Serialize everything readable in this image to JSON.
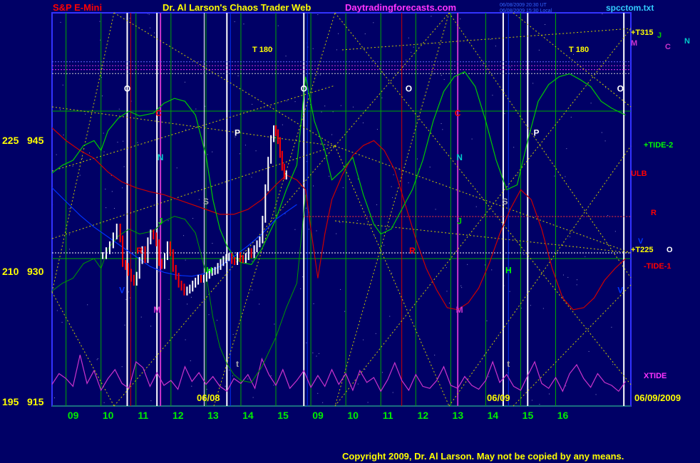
{
  "header": {
    "instrument": "S&P E-Mini",
    "title": "Dr. Al Larson's Chaos Trader Web",
    "site": "Daytradingforecasts.com",
    "stamp_ut": "06/08/2009 20:30 UT",
    "stamp_local": "06/08/2009 15:30 Local",
    "file": "spcctom.txt"
  },
  "footer": {
    "copyright": "Copyright 2009, Dr. Al Larson. May not be copied by any means."
  },
  "colors": {
    "background": "#000066",
    "border": "#3333ff",
    "grid": "#00aa00",
    "price_up": "#ffffff",
    "price_down": "#ff0000",
    "xtide": "#cc33cc",
    "tide": "#00cc00",
    "red_line": "#cc0000",
    "blue_line": "#0033ff",
    "yellow": "#ffff00",
    "dotted_yellow": "#cccc00"
  },
  "chart_data": {
    "type": "candlestick",
    "yaxis": {
      "ylim": [
        915,
        955
      ],
      "ticks": [
        {
          "left": "225",
          "right": "945",
          "value": 945
        },
        {
          "left": "210",
          "right": "930",
          "value": 930
        },
        {
          "left": "195",
          "right": "915",
          "value": 915
        }
      ]
    },
    "xaxis": {
      "session1_hours": [
        "09",
        "10",
        "11",
        "12",
        "13",
        "14",
        "15",
        "16"
      ],
      "session2_hours": [
        "09",
        "10",
        "11",
        "12",
        "13",
        "14",
        "15",
        "16"
      ],
      "date1": "06/08",
      "date2": "06/09",
      "date_end": "06/09/2009"
    },
    "right_labels": [
      {
        "text": "+T315",
        "color": "#ffff00"
      },
      {
        "text": "J",
        "color": "#00cc00"
      },
      {
        "text": "N",
        "color": "#00cccc"
      },
      {
        "text": "M",
        "color": "#cc33cc"
      },
      {
        "text": "C",
        "color": "#cc33cc"
      },
      {
        "text": "+TIDE-2",
        "color": "#00ff00"
      },
      {
        "text": "ULB",
        "color": "#ff0000"
      },
      {
        "text": "R",
        "color": "#ff0000"
      },
      {
        "text": "+T225",
        "color": "#ffff00"
      },
      {
        "text": "O",
        "color": "#ffffff"
      },
      {
        "text": "V",
        "color": "#0033ff"
      },
      {
        "text": "-TIDE-1",
        "color": "#ff0000"
      },
      {
        "text": "XTIDE",
        "color": "#ff33ff"
      }
    ],
    "t180": "T 180",
    "planet_markers": [
      {
        "text": "O",
        "color": "#ffffff",
        "x": 9.75,
        "y": 947
      },
      {
        "text": "C",
        "color": "#ff0000",
        "x": 10.65,
        "y": 944.5
      },
      {
        "text": "N",
        "color": "#00cccc",
        "x": 10.7,
        "y": 940
      },
      {
        "text": "J",
        "color": "#00cc00",
        "x": 10.7,
        "y": 933.5
      },
      {
        "text": "M",
        "color": "#cc33cc",
        "x": 10.6,
        "y": 924.5
      },
      {
        "text": "V",
        "color": "#0033ff",
        "x": 9.6,
        "y": 926.5
      },
      {
        "text": "R",
        "color": "#ff0000",
        "x": 10.1,
        "y": 930.5
      },
      {
        "text": "S",
        "color": "#aaaaaa",
        "x": 12.0,
        "y": 935.5
      },
      {
        "text": "H",
        "color": "#00ff00",
        "x": 12.1,
        "y": 928.5
      },
      {
        "text": "P",
        "color": "#ffffff",
        "x": 12.9,
        "y": 942.5
      },
      {
        "text": "t",
        "color": "#aaaaaa",
        "x": 12.9,
        "y": 919
      },
      {
        "text": "O",
        "color": "#ffffff",
        "x": 14.8,
        "y": 947
      },
      {
        "text": "O",
        "color": "#ffffff",
        "x": 17.8,
        "y": 947
      },
      {
        "text": "R",
        "color": "#ff0000",
        "x": 17.9,
        "y": 930.5
      },
      {
        "text": "C",
        "color": "#ff0000",
        "x": 19.2,
        "y": 944.5
      },
      {
        "text": "N",
        "color": "#00cccc",
        "x": 19.25,
        "y": 940
      },
      {
        "text": "J",
        "color": "#00cc00",
        "x": 19.25,
        "y": 933.5
      },
      {
        "text": "M",
        "color": "#cc33cc",
        "x": 19.25,
        "y": 924.5
      },
      {
        "text": "S",
        "color": "#aaaaaa",
        "x": 20.55,
        "y": 935.5
      },
      {
        "text": "H",
        "color": "#00ff00",
        "x": 20.65,
        "y": 928.5
      },
      {
        "text": "t",
        "color": "#aaaaaa",
        "x": 20.65,
        "y": 919
      },
      {
        "text": "P",
        "color": "#ffffff",
        "x": 21.45,
        "y": 942.5
      },
      {
        "text": "O",
        "color": "#ffffff",
        "x": 23.85,
        "y": 947
      },
      {
        "text": "V",
        "color": "#0033ff",
        "x": 23.85,
        "y": 926.5
      }
    ],
    "price_bars": [
      [
        9.05,
        930.3
      ],
      [
        9.15,
        930.8
      ],
      [
        9.25,
        931.4
      ],
      [
        9.35,
        932.3
      ],
      [
        9.45,
        933.2
      ],
      [
        9.55,
        932.0
      ],
      [
        9.62,
        929.5
      ],
      [
        9.7,
        929.2
      ],
      [
        9.78,
        928.6
      ],
      [
        9.86,
        928.0
      ],
      [
        9.94,
        927.6
      ],
      [
        10.02,
        928.3
      ],
      [
        10.1,
        929.8
      ],
      [
        10.18,
        930.9
      ],
      [
        10.26,
        929.9
      ],
      [
        10.34,
        931.8
      ],
      [
        10.42,
        932.6
      ],
      [
        10.5,
        932.3
      ],
      [
        10.58,
        931.6
      ],
      [
        10.66,
        929.6
      ],
      [
        10.74,
        929.3
      ],
      [
        10.82,
        930.2
      ],
      [
        10.9,
        931.4
      ],
      [
        10.98,
        930.6
      ],
      [
        11.06,
        929.0
      ],
      [
        11.14,
        928.2
      ],
      [
        11.22,
        927.4
      ],
      [
        11.3,
        927.1
      ],
      [
        11.38,
        926.6
      ],
      [
        11.46,
        926.8
      ],
      [
        11.54,
        927.0
      ],
      [
        11.62,
        927.4
      ],
      [
        11.7,
        927.7
      ],
      [
        11.78,
        928.0
      ],
      [
        11.86,
        927.9
      ],
      [
        11.94,
        928.0
      ],
      [
        12.02,
        928.3
      ],
      [
        12.1,
        928.6
      ],
      [
        12.18,
        928.7
      ],
      [
        12.26,
        928.8
      ],
      [
        12.34,
        929.2
      ],
      [
        12.42,
        929.6
      ],
      [
        12.5,
        929.9
      ],
      [
        12.58,
        930.1
      ],
      [
        12.66,
        930.2
      ],
      [
        12.74,
        929.8
      ],
      [
        12.82,
        929.7
      ],
      [
        12.9,
        930.3
      ],
      [
        12.98,
        930.0
      ],
      [
        13.06,
        929.9
      ],
      [
        13.14,
        930.2
      ],
      [
        13.22,
        930.7
      ],
      [
        13.3,
        930.4
      ],
      [
        13.38,
        931.0
      ],
      [
        13.46,
        931.5
      ],
      [
        13.54,
        931.9
      ],
      [
        13.62,
        934.0
      ],
      [
        13.7,
        937.2
      ],
      [
        13.78,
        940.0
      ],
      [
        13.86,
        942.2
      ],
      [
        13.94,
        943.2
      ],
      [
        14.0,
        942.8
      ],
      [
        14.06,
        942.0
      ],
      [
        14.12,
        940.6
      ],
      [
        14.18,
        939.3
      ],
      [
        14.24,
        938.4
      ],
      [
        14.3,
        938.6
      ]
    ],
    "xtide_wave": [
      [
        7.6,
        917.2
      ],
      [
        7.8,
        918.3
      ],
      [
        8.0,
        917.8
      ],
      [
        8.2,
        917.0
      ],
      [
        8.4,
        920.2
      ],
      [
        8.6,
        917.3
      ],
      [
        8.8,
        918.6
      ],
      [
        9.0,
        916.6
      ],
      [
        9.2,
        917.8
      ],
      [
        9.4,
        918.7
      ],
      [
        9.6,
        917.3
      ],
      [
        9.8,
        916.8
      ],
      [
        10.0,
        919.5
      ],
      [
        10.2,
        918.9
      ],
      [
        10.4,
        917.0
      ],
      [
        10.6,
        918.4
      ],
      [
        10.8,
        917.1
      ],
      [
        11.0,
        917.6
      ],
      [
        11.2,
        916.7
      ],
      [
        11.4,
        919.0
      ],
      [
        11.6,
        917.5
      ],
      [
        11.8,
        918.4
      ],
      [
        12.0,
        917.2
      ],
      [
        12.2,
        918.0
      ],
      [
        12.4,
        917.0
      ],
      [
        12.6,
        916.5
      ],
      [
        12.8,
        917.8
      ],
      [
        13.0,
        917.3
      ],
      [
        13.2,
        918.2
      ],
      [
        13.4,
        916.8
      ],
      [
        13.6,
        919.8
      ],
      [
        13.8,
        918.2
      ],
      [
        14.0,
        917.1
      ],
      [
        14.2,
        918.7
      ],
      [
        14.4,
        916.8
      ],
      [
        14.6,
        917.6
      ],
      [
        14.8,
        918.6
      ],
      [
        15.0,
        916.9
      ],
      [
        15.2,
        918.1
      ],
      [
        15.4,
        917.0
      ],
      [
        15.6,
        918.7
      ],
      [
        15.8,
        917.2
      ],
      [
        16.0,
        918.3
      ],
      [
        16.2,
        916.6
      ],
      [
        16.4,
        918.6
      ],
      [
        16.6,
        917.4
      ],
      [
        16.8,
        917.9
      ],
      [
        17.0,
        916.5
      ],
      [
        17.2,
        917.7
      ],
      [
        17.4,
        919.4
      ],
      [
        17.6,
        917.6
      ],
      [
        17.8,
        916.6
      ],
      [
        18.0,
        918.2
      ],
      [
        18.2,
        917.0
      ],
      [
        18.4,
        916.8
      ],
      [
        18.6,
        917.6
      ],
      [
        18.8,
        919.0
      ],
      [
        19.0,
        917.1
      ],
      [
        19.2,
        916.8
      ],
      [
        19.4,
        918.0
      ],
      [
        19.6,
        917.1
      ],
      [
        19.8,
        916.7
      ],
      [
        20.0,
        917.6
      ],
      [
        20.2,
        919.5
      ],
      [
        20.4,
        917.4
      ],
      [
        20.6,
        918.2
      ],
      [
        20.8,
        917.0
      ],
      [
        21.0,
        916.6
      ],
      [
        21.2,
        918.1
      ],
      [
        21.4,
        919.5
      ],
      [
        21.6,
        917.3
      ],
      [
        21.8,
        916.8
      ],
      [
        22.0,
        917.9
      ],
      [
        22.2,
        916.5
      ],
      [
        22.4,
        918.3
      ],
      [
        22.6,
        919.2
      ],
      [
        22.8,
        917.8
      ],
      [
        23.0,
        916.9
      ],
      [
        23.2,
        918.3
      ],
      [
        23.4,
        917.4
      ],
      [
        23.6,
        917.1
      ],
      [
        23.8,
        916.5
      ],
      [
        24.0,
        917.5
      ]
    ],
    "green_curve": [
      [
        7.6,
        938.7
      ],
      [
        7.9,
        939.5
      ],
      [
        8.2,
        940.0
      ],
      [
        8.5,
        941.5
      ],
      [
        8.8,
        942.0
      ],
      [
        9.0,
        941.0
      ],
      [
        9.2,
        943.0
      ],
      [
        9.5,
        944.3
      ],
      [
        9.8,
        945.0
      ],
      [
        10.1,
        944.5
      ],
      [
        10.5,
        944.8
      ],
      [
        10.8,
        945.8
      ],
      [
        11.1,
        946.3
      ],
      [
        11.4,
        946.0
      ],
      [
        11.7,
        944.6
      ],
      [
        12.0,
        940.5
      ],
      [
        12.2,
        936.0
      ],
      [
        12.4,
        933.0
      ],
      [
        12.6,
        931.3
      ],
      [
        12.8,
        930.2
      ],
      [
        13.0,
        929.6
      ],
      [
        13.3,
        929.4
      ],
      [
        13.6,
        931.0
      ],
      [
        14.0,
        934.0
      ],
      [
        14.3,
        937.0
      ],
      [
        14.6,
        939.5
      ],
      [
        14.85,
        948.5
      ],
      [
        15.1,
        944.0
      ],
      [
        15.4,
        941.0
      ],
      [
        15.6,
        938.0
      ],
      [
        15.9,
        939.0
      ],
      [
        16.2,
        940.3
      ],
      [
        16.5,
        936.5
      ],
      [
        16.8,
        933.5
      ],
      [
        17.0,
        932.5
      ],
      [
        17.3,
        933.0
      ],
      [
        17.6,
        935.0
      ],
      [
        17.9,
        937.0
      ],
      [
        18.2,
        940.0
      ],
      [
        18.5,
        944.0
      ],
      [
        18.8,
        947.0
      ],
      [
        19.1,
        948.5
      ],
      [
        19.4,
        949.0
      ],
      [
        19.7,
        947.5
      ],
      [
        20.0,
        944.0
      ],
      [
        20.3,
        940.0
      ],
      [
        20.6,
        937.0
      ],
      [
        20.9,
        937.5
      ],
      [
        21.2,
        942.0
      ],
      [
        21.5,
        946.0
      ],
      [
        21.8,
        947.7
      ],
      [
        22.1,
        948.5
      ],
      [
        22.4,
        948.8
      ],
      [
        22.7,
        948.2
      ],
      [
        23.0,
        947.5
      ],
      [
        23.3,
        946.0
      ],
      [
        23.6,
        945.3
      ],
      [
        24.0,
        944.6
      ]
    ],
    "red_curve": [
      [
        7.6,
        943.3
      ],
      [
        8.0,
        942.0
      ],
      [
        8.4,
        941.0
      ],
      [
        8.8,
        940.2
      ],
      [
        9.2,
        938.8
      ],
      [
        9.6,
        937.8
      ],
      [
        10.0,
        937.2
      ],
      [
        10.4,
        936.8
      ],
      [
        10.8,
        936.5
      ],
      [
        11.2,
        936.0
      ],
      [
        11.6,
        935.5
      ],
      [
        12.0,
        935.0
      ],
      [
        12.4,
        934.5
      ],
      [
        12.8,
        934.5
      ],
      [
        13.2,
        935.0
      ],
      [
        13.6,
        936.0
      ],
      [
        14.0,
        937.5
      ],
      [
        14.3,
        938.5
      ],
      [
        14.6,
        938.0
      ],
      [
        14.85,
        937.0
      ],
      [
        15.0,
        933.0
      ],
      [
        15.2,
        928.0
      ],
      [
        15.4,
        932.5
      ],
      [
        15.6,
        936.0
      ],
      [
        15.9,
        938.5
      ],
      [
        16.2,
        940.5
      ],
      [
        16.5,
        941.5
      ],
      [
        16.8,
        942.0
      ],
      [
        17.1,
        941.0
      ],
      [
        17.4,
        939.0
      ],
      [
        17.7,
        935.5
      ],
      [
        18.0,
        932.0
      ],
      [
        18.3,
        929.0
      ],
      [
        18.6,
        926.8
      ],
      [
        18.9,
        925.0
      ],
      [
        19.2,
        924.8
      ],
      [
        19.5,
        925.5
      ],
      [
        19.8,
        927.0
      ],
      [
        20.1,
        929.5
      ],
      [
        20.4,
        932.5
      ],
      [
        20.7,
        935.0
      ],
      [
        21.0,
        937.0
      ],
      [
        21.3,
        936.0
      ],
      [
        21.6,
        933.0
      ],
      [
        21.9,
        929.0
      ],
      [
        22.2,
        926.0
      ],
      [
        22.5,
        924.8
      ],
      [
        22.8,
        925.0
      ],
      [
        23.1,
        926.0
      ],
      [
        23.4,
        927.8
      ],
      [
        23.7,
        929.0
      ],
      [
        24.0,
        930.0
      ]
    ],
    "blue_curve": [
      [
        7.6,
        937.2
      ],
      [
        8.0,
        935.8
      ],
      [
        8.4,
        934.4
      ],
      [
        8.8,
        933.2
      ],
      [
        9.2,
        932.2
      ],
      [
        9.6,
        931.2
      ],
      [
        10.0,
        930.2
      ],
      [
        10.4,
        929.2
      ],
      [
        10.8,
        928.6
      ],
      [
        11.2,
        928.3
      ],
      [
        11.6,
        928.2
      ],
      [
        12.0,
        928.5
      ],
      [
        12.4,
        929.2
      ],
      [
        12.8,
        930.2
      ],
      [
        13.2,
        931.3
      ],
      [
        13.6,
        932.5
      ],
      [
        14.0,
        934.0
      ],
      [
        14.4,
        935.0
      ],
      [
        14.6,
        935.5
      ]
    ]
  }
}
